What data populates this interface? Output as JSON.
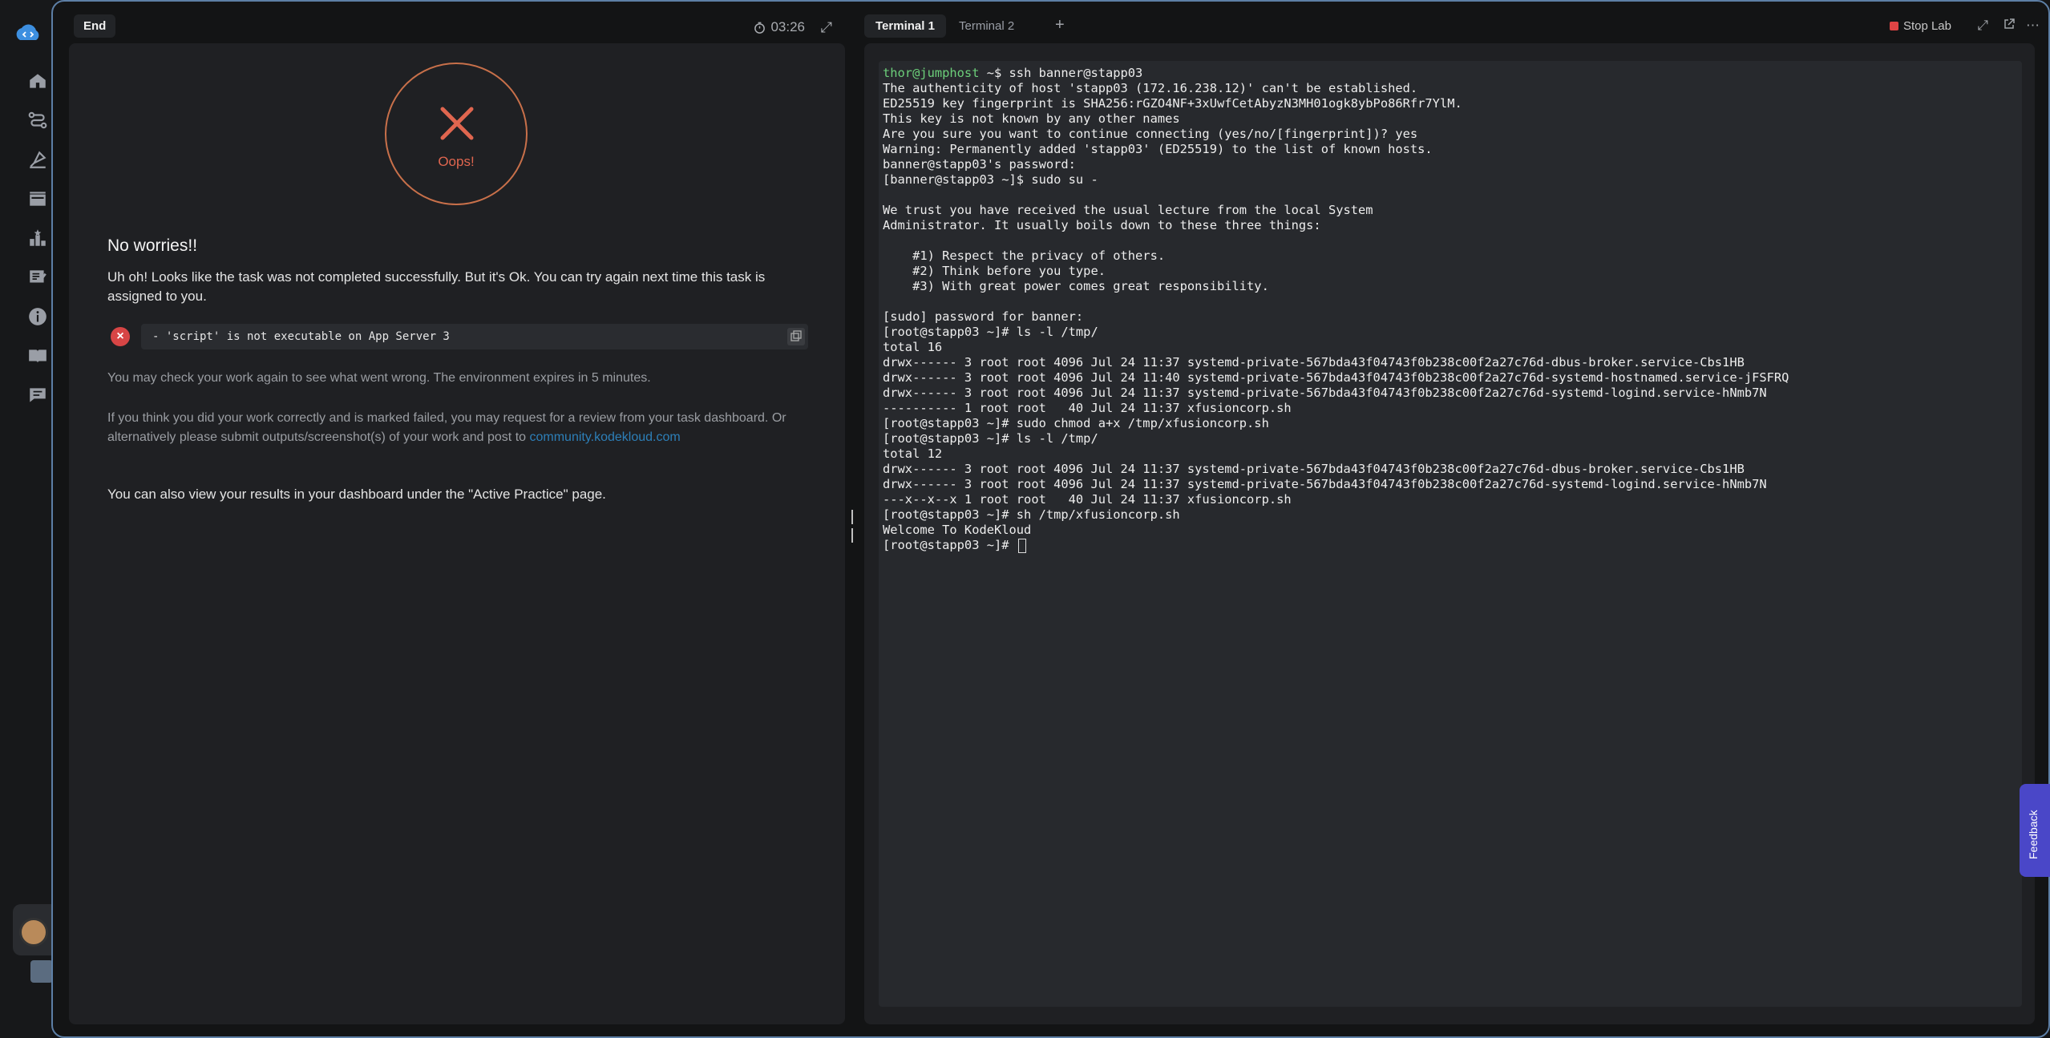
{
  "sidebar": {
    "items": [
      {
        "icon": "home-icon"
      },
      {
        "icon": "roadmap-icon"
      },
      {
        "icon": "labs-icon"
      },
      {
        "icon": "courses-icon"
      },
      {
        "icon": "leaderboard-icon"
      },
      {
        "icon": "notes-icon"
      },
      {
        "icon": "info-icon"
      },
      {
        "icon": "docs-icon"
      },
      {
        "icon": "chat-icon"
      }
    ]
  },
  "left": {
    "tab_label": "End",
    "timer": "03:26",
    "oops": "Oops!",
    "title": "No worries!!",
    "message": "Uh oh! Looks like the task was not completed successfully. But it's Ok. You can try again next time this task is assigned to you.",
    "error": "- 'script' is not executable on App Server 3",
    "check_text": "You may check your work again to see what went wrong. The environment expires in 5 minutes.",
    "review_text": "If you think you did your work correctly and is marked failed, you may request for a review from your task dashboard. Or alternatively please submit outputs/screenshot(s) of your work and post to",
    "review_link": "community.kodekloud.com",
    "dashboard_text": "You can also view your results in your dashboard under the \"Active Practice\" page."
  },
  "right": {
    "tabs": [
      "Terminal 1",
      "Terminal 2"
    ],
    "add_tab": "+",
    "stop_lab": "Stop Lab",
    "terminal": {
      "first_prompt": "thor@jumphost",
      "first_rest": " ~$ ssh banner@stapp03",
      "lines": [
        "The authenticity of host 'stapp03 (172.16.238.12)' can't be established.",
        "ED25519 key fingerprint is SHA256:rGZO4NF+3xUwfCetAbyzN3MH01ogk8ybPo86Rfr7YlM.",
        "This key is not known by any other names",
        "Are you sure you want to continue connecting (yes/no/[fingerprint])? yes",
        "Warning: Permanently added 'stapp03' (ED25519) to the list of known hosts.",
        "banner@stapp03's password: ",
        "[banner@stapp03 ~]$ sudo su -",
        "",
        "We trust you have received the usual lecture from the local System",
        "Administrator. It usually boils down to these three things:",
        "",
        "    #1) Respect the privacy of others.",
        "    #2) Think before you type.",
        "    #3) With great power comes great responsibility.",
        "",
        "[sudo] password for banner: ",
        "[root@stapp03 ~]# ls -l /tmp/",
        "total 16",
        "drwx------ 3 root root 4096 Jul 24 11:37 systemd-private-567bda43f04743f0b238c00f2a27c76d-dbus-broker.service-Cbs1HB",
        "drwx------ 3 root root 4096 Jul 24 11:40 systemd-private-567bda43f04743f0b238c00f2a27c76d-systemd-hostnamed.service-jFSFRQ",
        "drwx------ 3 root root 4096 Jul 24 11:37 systemd-private-567bda43f04743f0b238c00f2a27c76d-systemd-logind.service-hNmb7N",
        "---------- 1 root root   40 Jul 24 11:37 xfusioncorp.sh",
        "[root@stapp03 ~]# sudo chmod a+x /tmp/xfusioncorp.sh",
        "[root@stapp03 ~]# ls -l /tmp/",
        "total 12",
        "drwx------ 3 root root 4096 Jul 24 11:37 systemd-private-567bda43f04743f0b238c00f2a27c76d-dbus-broker.service-Cbs1HB",
        "drwx------ 3 root root 4096 Jul 24 11:37 systemd-private-567bda43f04743f0b238c00f2a27c76d-systemd-logind.service-hNmb7N",
        "---x--x--x 1 root root   40 Jul 24 11:37 xfusioncorp.sh",
        "[root@stapp03 ~]# sh /tmp/xfusioncorp.sh",
        "Welcome To KodeKloud"
      ],
      "last_prompt": "[root@stapp03 ~]# "
    }
  },
  "feedback_label": "Feedback",
  "colors": {
    "accent": "#5d7fa6",
    "error": "#d74545",
    "oops": "#e0664f",
    "feedback": "#4a47c8",
    "prompt": "#6ccf7a"
  }
}
